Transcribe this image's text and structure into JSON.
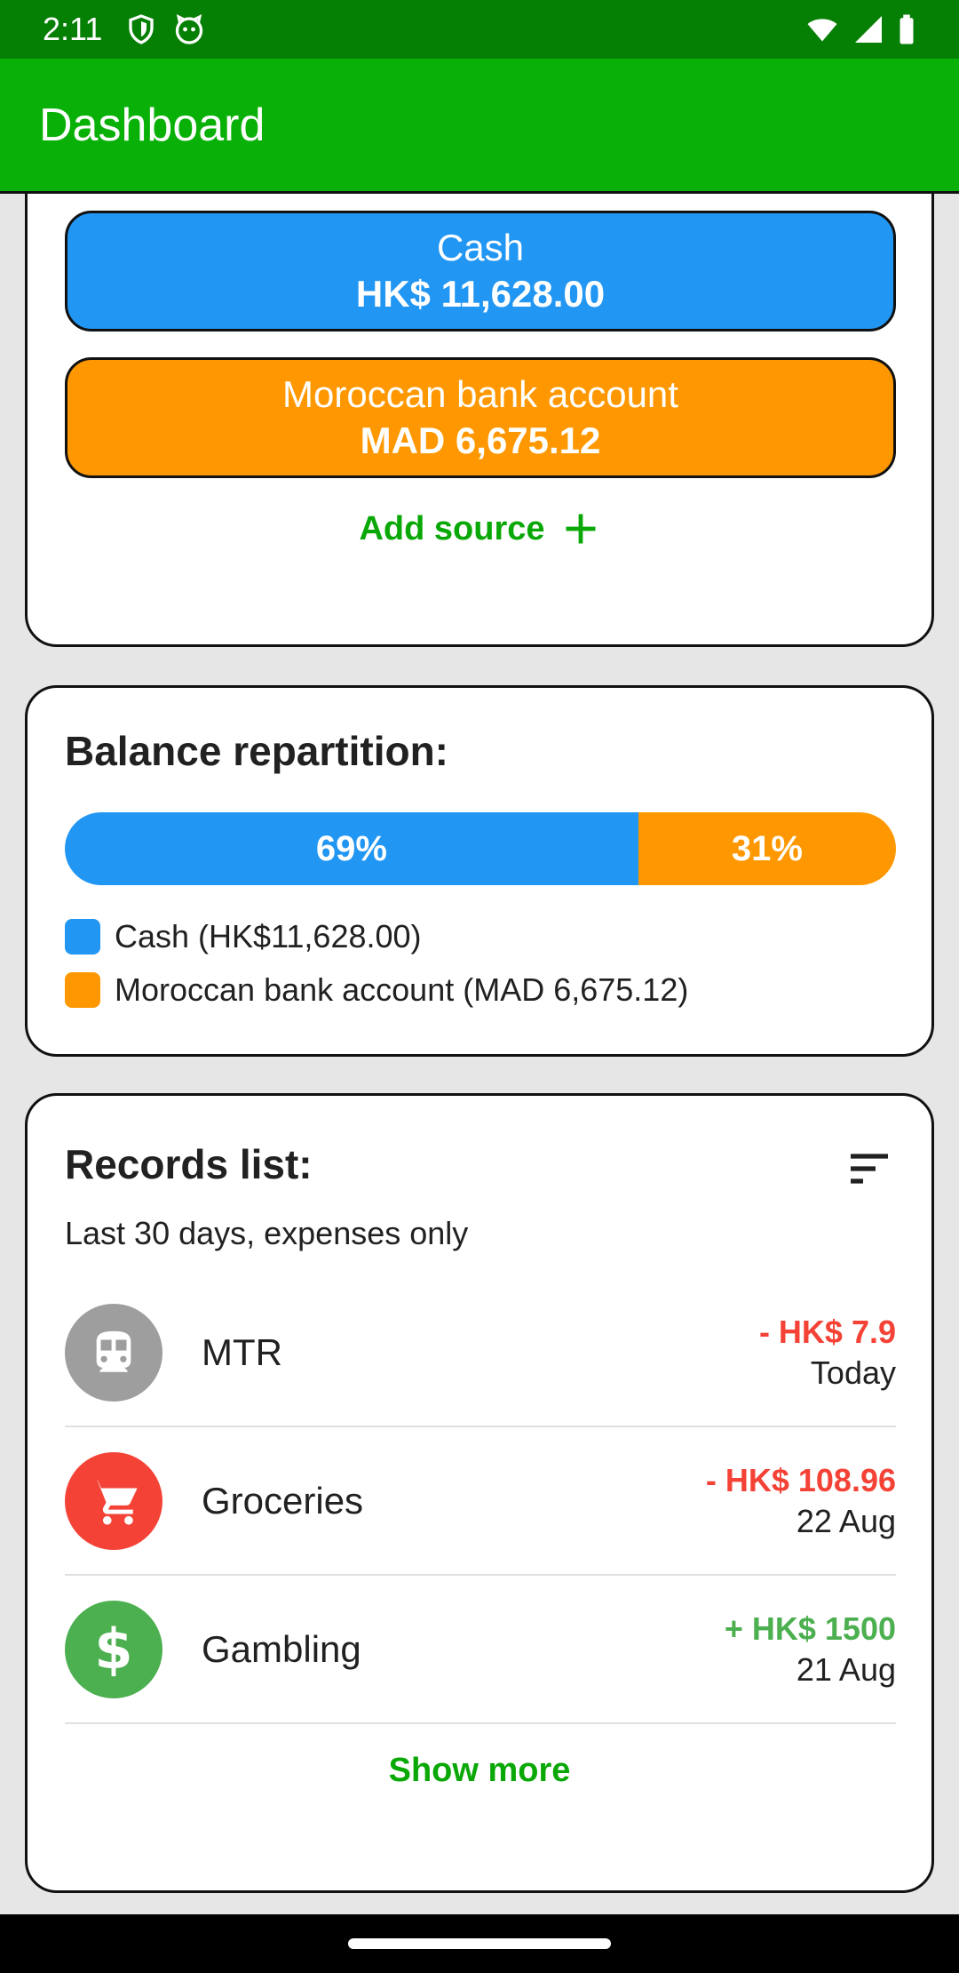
{
  "status_bar": {
    "time": "2:11"
  },
  "app_bar": {
    "title": "Dashboard"
  },
  "sources": {
    "items": [
      {
        "name": "Cash",
        "amount": "HK$ 11,628.00",
        "color": "#2196f3"
      },
      {
        "name": "Moroccan bank account",
        "amount": "MAD 6,675.12",
        "color": "#ff9800"
      }
    ],
    "add_label": "Add source"
  },
  "balance": {
    "title": "Balance repartition:",
    "segments": [
      {
        "label": "69%",
        "share": 0.69,
        "color": "#2196f3"
      },
      {
        "label": "31%",
        "share": 0.31,
        "color": "#ff9800"
      }
    ],
    "legend": [
      {
        "text": "Cash (HK$11,628.00)",
        "color": "#2196f3"
      },
      {
        "text": "Moroccan bank account (MAD 6,675.12)",
        "color": "#ff9800"
      }
    ]
  },
  "records": {
    "title": "Records list:",
    "subtitle": "Last 30 days, expenses only",
    "items": [
      {
        "name": "MTR",
        "amount": "- HK$ 7.9",
        "date": "Today",
        "icon": "train-icon",
        "icon_bg": "#9e9e9e",
        "amount_color": "#f44336"
      },
      {
        "name": "Groceries",
        "amount": "- HK$ 108.96",
        "date": "22 Aug",
        "icon": "cart-icon",
        "icon_bg": "#f44336",
        "amount_color": "#f44336"
      },
      {
        "name": "Gambling",
        "amount": "+ HK$ 1500",
        "date": "21 Aug",
        "icon": "dollar-icon",
        "icon_bg": "#4caf50",
        "amount_color": "#4caf50"
      }
    ],
    "show_more": "Show more"
  },
  "colors": {
    "accent": "#09b007",
    "status_bar": "#067f05",
    "link_green": "#09a807"
  }
}
